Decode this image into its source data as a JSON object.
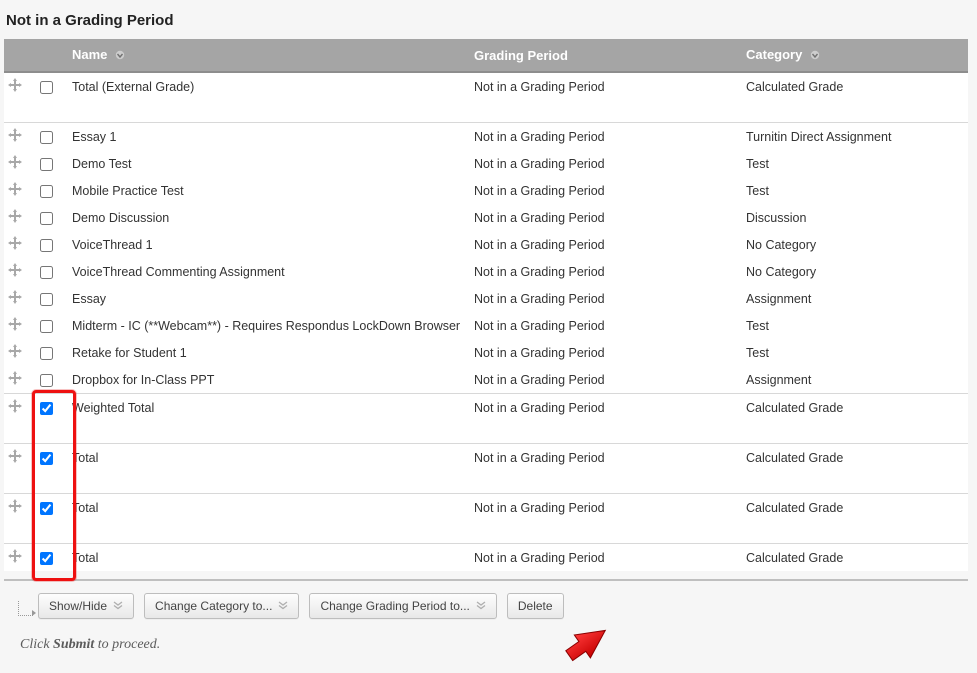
{
  "section_title": "Not in a Grading Period",
  "columns": {
    "name_label": "Name",
    "period_label": "Grading Period",
    "category_label": "Category"
  },
  "rows": [
    {
      "name": "Total (External Grade)",
      "period": "Not in a Grading Period",
      "category": "Calculated Grade",
      "checked": false,
      "separator_before": false,
      "spacer_after": true
    },
    {
      "name": "Essay 1",
      "period": "Not in a Grading Period",
      "category": "Turnitin Direct Assignment",
      "checked": false,
      "separator_before": true
    },
    {
      "name": "Demo Test",
      "period": "Not in a Grading Period",
      "category": "Test",
      "checked": false
    },
    {
      "name": "Mobile Practice Test",
      "period": "Not in a Grading Period",
      "category": "Test",
      "checked": false
    },
    {
      "name": "Demo Discussion",
      "period": "Not in a Grading Period",
      "category": "Discussion",
      "checked": false
    },
    {
      "name": "VoiceThread 1",
      "period": "Not in a Grading Period",
      "category": "No Category",
      "checked": false
    },
    {
      "name": "VoiceThread Commenting Assignment",
      "period": "Not in a Grading Period",
      "category": "No Category",
      "checked": false
    },
    {
      "name": "Essay",
      "period": "Not in a Grading Period",
      "category": "Assignment",
      "checked": false
    },
    {
      "name": "Midterm - IC (**Webcam**) - Requires Respondus LockDown Browser",
      "period": "Not in a Grading Period",
      "category": "Test",
      "checked": false
    },
    {
      "name": "Retake for Student 1",
      "period": "Not in a Grading Period",
      "category": "Test",
      "checked": false
    },
    {
      "name": "Dropbox for In-Class PPT",
      "period": "Not in a Grading Period",
      "category": "Assignment",
      "checked": false
    },
    {
      "name": "Weighted Total",
      "period": "Not in a Grading Period",
      "category": "Calculated Grade",
      "checked": true,
      "separator_before": true,
      "spacer_after": true
    },
    {
      "name": "Total",
      "period": "Not in a Grading Period",
      "category": "Calculated Grade",
      "checked": true,
      "separator_before": true,
      "spacer_after": true
    },
    {
      "name": "Total",
      "period": "Not in a Grading Period",
      "category": "Calculated Grade",
      "checked": true,
      "separator_before": true,
      "spacer_after": true
    },
    {
      "name": "Total",
      "period": "Not in a Grading Period",
      "category": "Calculated Grade",
      "checked": true,
      "separator_before": true
    }
  ],
  "toolbar": {
    "show_hide_label": "Show/Hide",
    "change_category_label": "Change Category to...",
    "change_period_label": "Change Grading Period to...",
    "delete_label": "Delete"
  },
  "submit_line": {
    "prefix": "Click ",
    "bold": "Submit",
    "suffix": " to proceed."
  },
  "icons": {
    "drag_handle": "move-icon",
    "sort_chevron": "chevron-down-icon",
    "btn_chevron": "double-chevron-down-icon",
    "red_arrow": "pointer-arrow-icon"
  },
  "highlight": {
    "note": "Red rectangle highlights the four checked checkboxes for Weighted Total + 3×Total; red arrow points at the Delete button."
  }
}
